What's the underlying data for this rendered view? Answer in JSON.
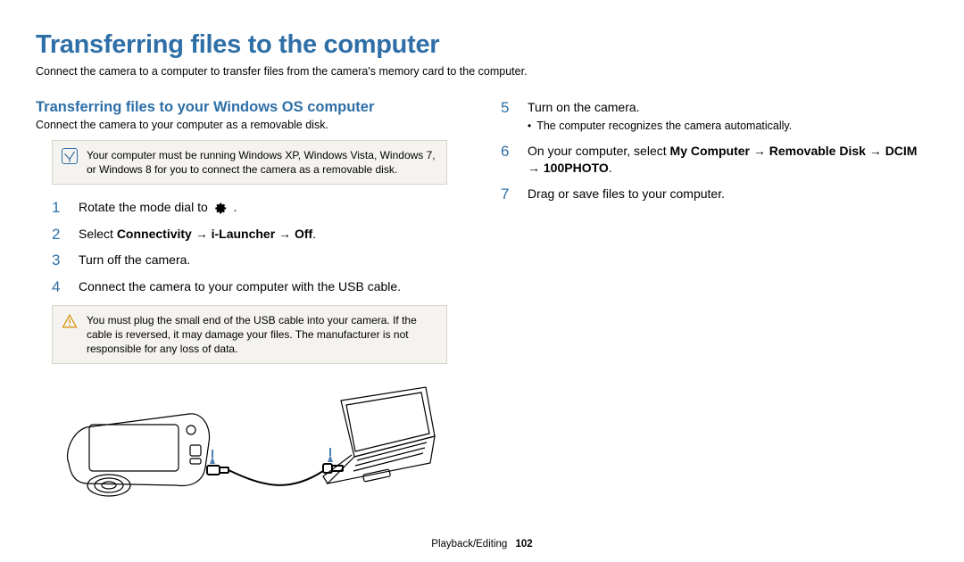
{
  "title": "Transferring files to the computer",
  "intro": "Connect the camera to a computer to transfer files from the camera's memory card to the computer.",
  "section_heading": "Transferring files to your Windows OS computer",
  "section_sub": "Connect the camera to your computer as a removable disk.",
  "note_info": "Your computer must be running Windows XP, Windows Vista, Windows 7, or Windows 8 for you to connect the camera as a removable disk.",
  "note_warn": "You must plug the small end of the USB cable into your camera. If the cable is reversed, it may damage your files. The manufacturer is not responsible for any loss of data.",
  "steps": {
    "s1": {
      "num": "1",
      "pre": "Rotate the mode dial to ",
      "post": "."
    },
    "s2": {
      "num": "2",
      "plain": "Select ",
      "bold": "Connectivity → i-Launcher → Off",
      "tail": "."
    },
    "s3": {
      "num": "3",
      "text": "Turn off the camera."
    },
    "s4": {
      "num": "4",
      "text": "Connect the camera to your computer with the USB cable."
    },
    "s5": {
      "num": "5",
      "text": "Turn on the camera.",
      "bullet": "The computer recognizes the camera automatically."
    },
    "s6": {
      "num": "6",
      "plain": "On your computer, select ",
      "bold": "My Computer → Removable Disk → DCIM → 100PHOTO",
      "tail": "."
    },
    "s7": {
      "num": "7",
      "text": "Drag or save files to your computer."
    }
  },
  "footer_section": "Playback/Editing",
  "footer_page": "102"
}
